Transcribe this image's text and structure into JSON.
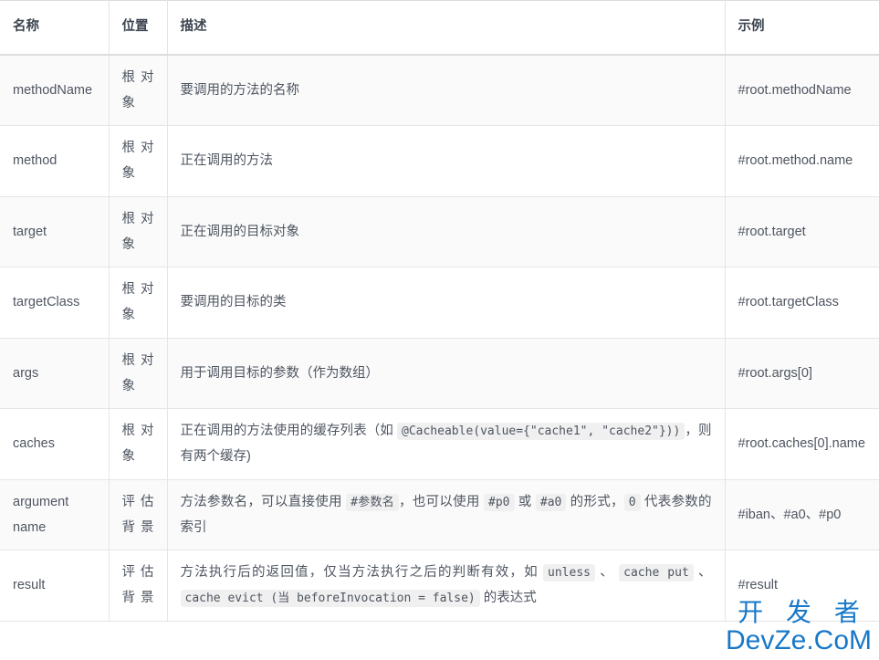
{
  "table": {
    "headers": [
      "名称",
      "位置",
      "描述",
      "示例"
    ],
    "rows": [
      {
        "name": "methodName",
        "location_line1": "根 对",
        "location_line2": "象",
        "description_parts": [
          {
            "type": "text",
            "value": "要调用的方法的名称"
          }
        ],
        "example": "#root.methodName"
      },
      {
        "name": "method",
        "location_line1": "根 对",
        "location_line2": "象",
        "description_parts": [
          {
            "type": "text",
            "value": "正在调用的方法"
          }
        ],
        "example": "#root.method.name"
      },
      {
        "name": "target",
        "location_line1": "根 对",
        "location_line2": "象",
        "description_parts": [
          {
            "type": "text",
            "value": "正在调用的目标对象"
          }
        ],
        "example": "#root.target"
      },
      {
        "name": "targetClass",
        "location_line1": "根 对",
        "location_line2": "象",
        "description_parts": [
          {
            "type": "text",
            "value": "要调用的目标的类"
          }
        ],
        "example": "#root.targetClass"
      },
      {
        "name": "args",
        "location_line1": "根 对",
        "location_line2": "象",
        "description_parts": [
          {
            "type": "text",
            "value": "用于调用目标的参数（作为数组）"
          }
        ],
        "example": "#root.args[0]"
      },
      {
        "name": "caches",
        "location_line1": "根 对",
        "location_line2": "象",
        "description_parts": [
          {
            "type": "text",
            "value": "正在调用的方法使用的缓存列表（如 "
          },
          {
            "type": "code",
            "value": "@Cacheable(value={\"cache1\", \"cache2\"}))"
          },
          {
            "type": "text",
            "value": "，则有两个缓存)"
          }
        ],
        "example": "#root.caches[0].name"
      },
      {
        "name": "argument name",
        "location_line1": "评 估",
        "location_line2": "背景",
        "description_parts": [
          {
            "type": "text",
            "value": "方法参数名，可以直接使用 "
          },
          {
            "type": "code",
            "value": "#参数名"
          },
          {
            "type": "text",
            "value": "，也可以使用 "
          },
          {
            "type": "code",
            "value": "#p0"
          },
          {
            "type": "text",
            "value": " 或 "
          },
          {
            "type": "code",
            "value": "#a0"
          },
          {
            "type": "text",
            "value": " 的形式，"
          },
          {
            "type": "code",
            "value": "0"
          },
          {
            "type": "text",
            "value": " 代表参数的索引"
          }
        ],
        "example": "#iban、#a0、#p0"
      },
      {
        "name": "result",
        "location_line1": "评 估",
        "location_line2": "背景",
        "description_parts": [
          {
            "type": "text",
            "value": "方法执行后的返回值，仅当方法执行之后的判断有效，如 "
          },
          {
            "type": "code",
            "value": "unless"
          },
          {
            "type": "text",
            "value": " 、 "
          },
          {
            "type": "code",
            "value": "cache put"
          },
          {
            "type": "text",
            "value": " 、 "
          },
          {
            "type": "code",
            "value": "cache evict (当 beforeInvocation = false)"
          },
          {
            "type": "text",
            "value": " 的表达式"
          }
        ],
        "example": "#result"
      }
    ]
  },
  "watermark": {
    "top": "开 发 者",
    "bottom": "DevZe.CoM",
    "color": "#1878c8"
  },
  "colors": {
    "header_text": "#3c4450",
    "body_text": "#4e5560",
    "row_stripe": "#fafafa",
    "border": "#e6e6e6",
    "code_bg": "#f0f0f0"
  }
}
